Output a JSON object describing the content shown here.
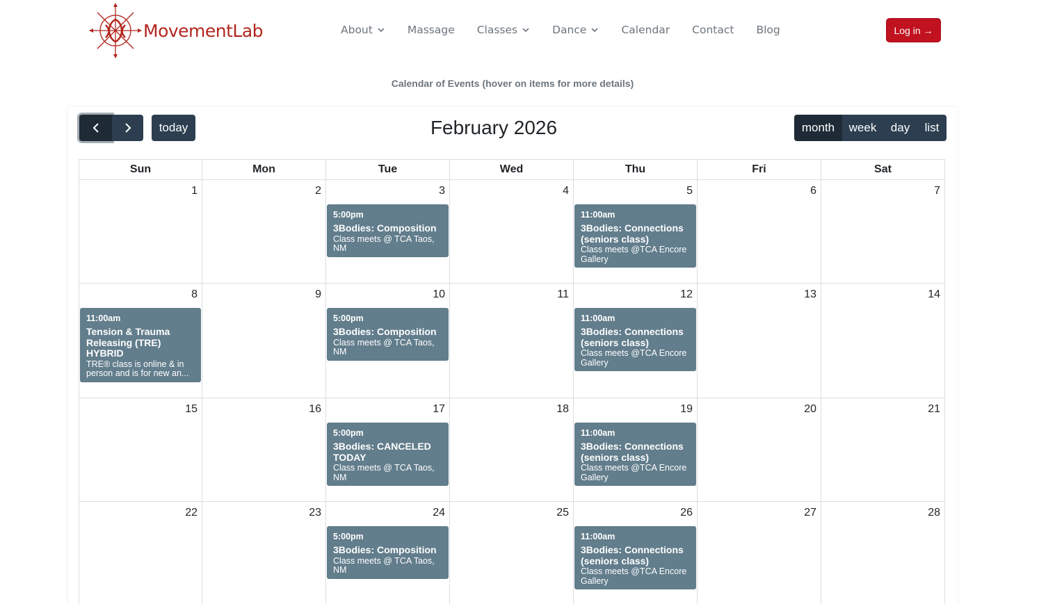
{
  "brand": {
    "name": "MovementLab",
    "color": "#b3261e"
  },
  "nav": [
    {
      "label": "About",
      "dropdown": true
    },
    {
      "label": "Massage",
      "dropdown": false
    },
    {
      "label": "Classes",
      "dropdown": true
    },
    {
      "label": "Dance",
      "dropdown": true
    },
    {
      "label": "Calendar",
      "dropdown": false
    },
    {
      "label": "Contact",
      "dropdown": false
    },
    {
      "label": "Blog",
      "dropdown": false
    }
  ],
  "login": {
    "label": "Log in →"
  },
  "caption": "Calendar of Events (hover on items for more details)",
  "calendar": {
    "title": "February 2026",
    "prev_icon": "chevron-left-icon",
    "next_icon": "chevron-right-icon",
    "today_label": "today",
    "views": [
      "month",
      "week",
      "day",
      "list"
    ],
    "active_view": "month",
    "weekdays": [
      "Sun",
      "Mon",
      "Tue",
      "Wed",
      "Thu",
      "Fri",
      "Sat"
    ],
    "weeks": [
      {
        "days": [
          {
            "num": "1"
          },
          {
            "num": "2"
          },
          {
            "num": "3",
            "event": {
              "time": "5:00pm",
              "title": "3Bodies: Composition",
              "desc": "Class meets @ TCA Taos, NM"
            }
          },
          {
            "num": "4"
          },
          {
            "num": "5",
            "event": {
              "time": "11:00am",
              "title": "3Bodies: Connections (seniors class)",
              "desc": "Class meets @TCA Encore Gallery"
            }
          },
          {
            "num": "6"
          },
          {
            "num": "7"
          }
        ]
      },
      {
        "days": [
          {
            "num": "8",
            "event": {
              "time": "11:00am",
              "title": "Tension & Trauma Releasing (TRE) HYBRID",
              "desc": "TRE® class is online & in person and is for new an..."
            }
          },
          {
            "num": "9"
          },
          {
            "num": "10",
            "event": {
              "time": "5:00pm",
              "title": "3Bodies: Composition",
              "desc": "Class meets @ TCA Taos, NM"
            }
          },
          {
            "num": "11"
          },
          {
            "num": "12",
            "event": {
              "time": "11:00am",
              "title": "3Bodies: Connections (seniors class)",
              "desc": "Class meets @TCA Encore Gallery"
            }
          },
          {
            "num": "13"
          },
          {
            "num": "14"
          }
        ]
      },
      {
        "days": [
          {
            "num": "15"
          },
          {
            "num": "16"
          },
          {
            "num": "17",
            "event": {
              "time": "5:00pm",
              "title": "3Bodies: CANCELED TODAY",
              "desc": "Class meets @ TCA Taos, NM"
            }
          },
          {
            "num": "18"
          },
          {
            "num": "19",
            "event": {
              "time": "11:00am",
              "title": "3Bodies: Connections (seniors class)",
              "desc": "Class meets @TCA Encore Gallery"
            }
          },
          {
            "num": "20"
          },
          {
            "num": "21"
          }
        ]
      },
      {
        "days": [
          {
            "num": "22"
          },
          {
            "num": "23"
          },
          {
            "num": "24",
            "event": {
              "time": "5:00pm",
              "title": "3Bodies: Composition",
              "desc": "Class meets @ TCA Taos, NM"
            }
          },
          {
            "num": "25"
          },
          {
            "num": "26",
            "event": {
              "time": "11:00am",
              "title": "3Bodies: Connections (seniors class)",
              "desc": "Class meets @TCA Encore Gallery"
            }
          },
          {
            "num": "27"
          },
          {
            "num": "28"
          }
        ]
      }
    ]
  },
  "colors": {
    "button": "#2c3e50",
    "button_active": "#1e2b37",
    "event": "#627d8c",
    "login": "#c1121f",
    "caption": "#6c757d"
  }
}
